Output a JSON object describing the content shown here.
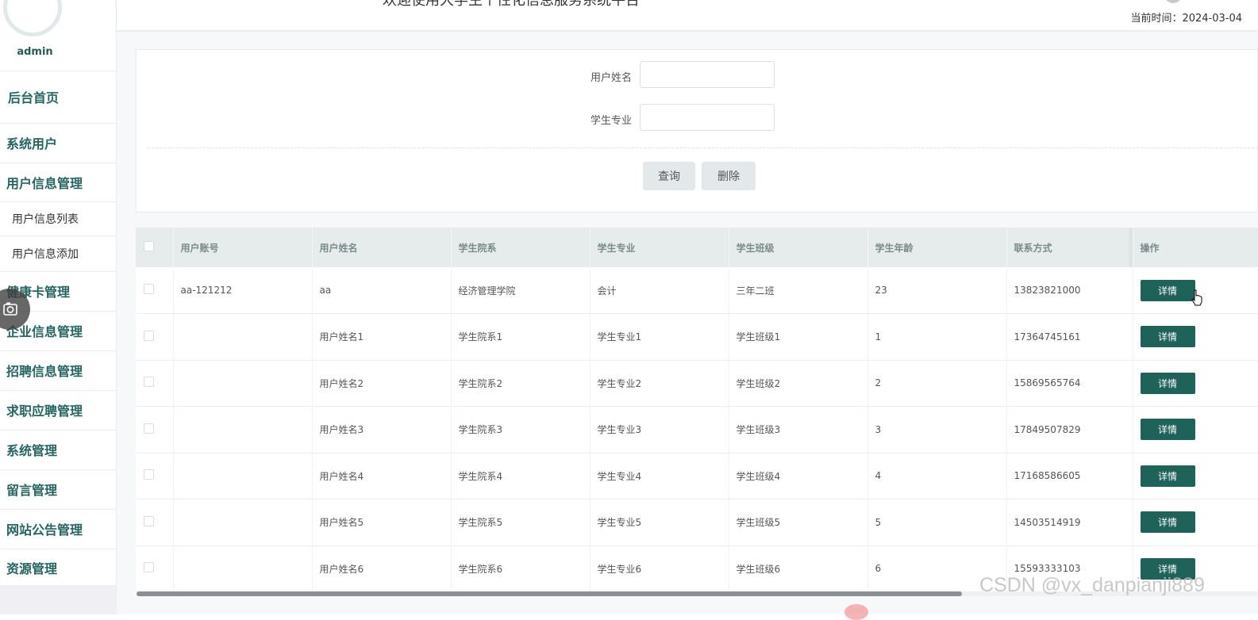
{
  "sidebar": {
    "username": "admin",
    "items": [
      {
        "label": "后台首页"
      },
      {
        "label": "系统用户"
      },
      {
        "label": "用户信息管理"
      },
      {
        "label": "用户信息列表"
      },
      {
        "label": "用户信息添加"
      },
      {
        "label": "健康卡管理"
      },
      {
        "label": "企业信息管理"
      },
      {
        "label": "招聘信息管理"
      },
      {
        "label": "求职应聘管理"
      },
      {
        "label": "系统管理"
      },
      {
        "label": "留言管理"
      },
      {
        "label": "网站公告管理"
      },
      {
        "label": "资源管理"
      }
    ]
  },
  "header": {
    "title": "欢迎使用大学生个性化信息服务系统平台",
    "current_time": "当前时间：2024-03-04"
  },
  "search": {
    "username_label": "用户姓名",
    "username_value": "",
    "major_label": "学生专业",
    "major_value": "",
    "query_button": "查询",
    "delete_button": "删除"
  },
  "table": {
    "columns": [
      "用户账号",
      "用户姓名",
      "学生院系",
      "学生专业",
      "学生班级",
      "学生年龄",
      "联系方式",
      "操作"
    ],
    "detail_label": "详情",
    "rows": [
      [
        "aa-121212",
        "aa",
        "经济管理学院",
        "会计",
        "三年二班",
        "23",
        "13823821000"
      ],
      [
        "",
        "用户姓名1",
        "学生院系1",
        "学生专业1",
        "学生班级1",
        "1",
        "17364745161"
      ],
      [
        "",
        "用户姓名2",
        "学生院系2",
        "学生专业2",
        "学生班级2",
        "2",
        "15869565764"
      ],
      [
        "",
        "用户姓名3",
        "学生院系3",
        "学生专业3",
        "学生班级3",
        "3",
        "17849507829"
      ],
      [
        "",
        "用户姓名4",
        "学生院系4",
        "学生专业4",
        "学生班级4",
        "4",
        "17168586605"
      ],
      [
        "",
        "用户姓名5",
        "学生院系5",
        "学生专业5",
        "学生班级5",
        "5",
        "14503514919"
      ],
      [
        "",
        "用户姓名6",
        "学生院系6",
        "学生专业6",
        "学生班级6",
        "6",
        "15593333103"
      ]
    ]
  },
  "watermark": "CSDN @vx_danpianji889",
  "colors": {
    "accent": "#1f625a",
    "nav_text": "#256460",
    "table_header_bg": "#e6eceb"
  }
}
